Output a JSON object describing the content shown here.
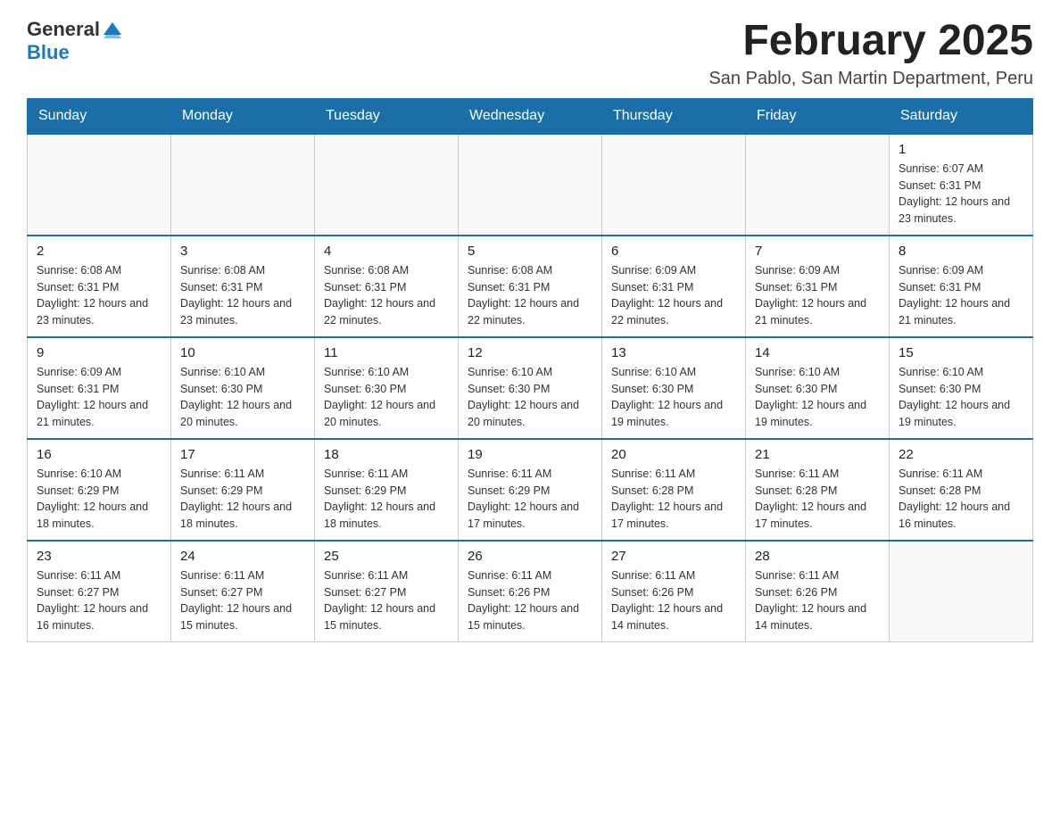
{
  "header": {
    "logo": {
      "general": "General",
      "blue": "Blue"
    },
    "title": "February 2025",
    "location": "San Pablo, San Martin Department, Peru"
  },
  "days_of_week": [
    "Sunday",
    "Monday",
    "Tuesday",
    "Wednesday",
    "Thursday",
    "Friday",
    "Saturday"
  ],
  "weeks": [
    {
      "days": [
        {
          "number": "",
          "info": ""
        },
        {
          "number": "",
          "info": ""
        },
        {
          "number": "",
          "info": ""
        },
        {
          "number": "",
          "info": ""
        },
        {
          "number": "",
          "info": ""
        },
        {
          "number": "",
          "info": ""
        },
        {
          "number": "1",
          "info": "Sunrise: 6:07 AM\nSunset: 6:31 PM\nDaylight: 12 hours and 23 minutes."
        }
      ]
    },
    {
      "days": [
        {
          "number": "2",
          "info": "Sunrise: 6:08 AM\nSunset: 6:31 PM\nDaylight: 12 hours and 23 minutes."
        },
        {
          "number": "3",
          "info": "Sunrise: 6:08 AM\nSunset: 6:31 PM\nDaylight: 12 hours and 23 minutes."
        },
        {
          "number": "4",
          "info": "Sunrise: 6:08 AM\nSunset: 6:31 PM\nDaylight: 12 hours and 22 minutes."
        },
        {
          "number": "5",
          "info": "Sunrise: 6:08 AM\nSunset: 6:31 PM\nDaylight: 12 hours and 22 minutes."
        },
        {
          "number": "6",
          "info": "Sunrise: 6:09 AM\nSunset: 6:31 PM\nDaylight: 12 hours and 22 minutes."
        },
        {
          "number": "7",
          "info": "Sunrise: 6:09 AM\nSunset: 6:31 PM\nDaylight: 12 hours and 21 minutes."
        },
        {
          "number": "8",
          "info": "Sunrise: 6:09 AM\nSunset: 6:31 PM\nDaylight: 12 hours and 21 minutes."
        }
      ]
    },
    {
      "days": [
        {
          "number": "9",
          "info": "Sunrise: 6:09 AM\nSunset: 6:31 PM\nDaylight: 12 hours and 21 minutes."
        },
        {
          "number": "10",
          "info": "Sunrise: 6:10 AM\nSunset: 6:30 PM\nDaylight: 12 hours and 20 minutes."
        },
        {
          "number": "11",
          "info": "Sunrise: 6:10 AM\nSunset: 6:30 PM\nDaylight: 12 hours and 20 minutes."
        },
        {
          "number": "12",
          "info": "Sunrise: 6:10 AM\nSunset: 6:30 PM\nDaylight: 12 hours and 20 minutes."
        },
        {
          "number": "13",
          "info": "Sunrise: 6:10 AM\nSunset: 6:30 PM\nDaylight: 12 hours and 19 minutes."
        },
        {
          "number": "14",
          "info": "Sunrise: 6:10 AM\nSunset: 6:30 PM\nDaylight: 12 hours and 19 minutes."
        },
        {
          "number": "15",
          "info": "Sunrise: 6:10 AM\nSunset: 6:30 PM\nDaylight: 12 hours and 19 minutes."
        }
      ]
    },
    {
      "days": [
        {
          "number": "16",
          "info": "Sunrise: 6:10 AM\nSunset: 6:29 PM\nDaylight: 12 hours and 18 minutes."
        },
        {
          "number": "17",
          "info": "Sunrise: 6:11 AM\nSunset: 6:29 PM\nDaylight: 12 hours and 18 minutes."
        },
        {
          "number": "18",
          "info": "Sunrise: 6:11 AM\nSunset: 6:29 PM\nDaylight: 12 hours and 18 minutes."
        },
        {
          "number": "19",
          "info": "Sunrise: 6:11 AM\nSunset: 6:29 PM\nDaylight: 12 hours and 17 minutes."
        },
        {
          "number": "20",
          "info": "Sunrise: 6:11 AM\nSunset: 6:28 PM\nDaylight: 12 hours and 17 minutes."
        },
        {
          "number": "21",
          "info": "Sunrise: 6:11 AM\nSunset: 6:28 PM\nDaylight: 12 hours and 17 minutes."
        },
        {
          "number": "22",
          "info": "Sunrise: 6:11 AM\nSunset: 6:28 PM\nDaylight: 12 hours and 16 minutes."
        }
      ]
    },
    {
      "days": [
        {
          "number": "23",
          "info": "Sunrise: 6:11 AM\nSunset: 6:27 PM\nDaylight: 12 hours and 16 minutes."
        },
        {
          "number": "24",
          "info": "Sunrise: 6:11 AM\nSunset: 6:27 PM\nDaylight: 12 hours and 15 minutes."
        },
        {
          "number": "25",
          "info": "Sunrise: 6:11 AM\nSunset: 6:27 PM\nDaylight: 12 hours and 15 minutes."
        },
        {
          "number": "26",
          "info": "Sunrise: 6:11 AM\nSunset: 6:26 PM\nDaylight: 12 hours and 15 minutes."
        },
        {
          "number": "27",
          "info": "Sunrise: 6:11 AM\nSunset: 6:26 PM\nDaylight: 12 hours and 14 minutes."
        },
        {
          "number": "28",
          "info": "Sunrise: 6:11 AM\nSunset: 6:26 PM\nDaylight: 12 hours and 14 minutes."
        },
        {
          "number": "",
          "info": ""
        }
      ]
    }
  ]
}
